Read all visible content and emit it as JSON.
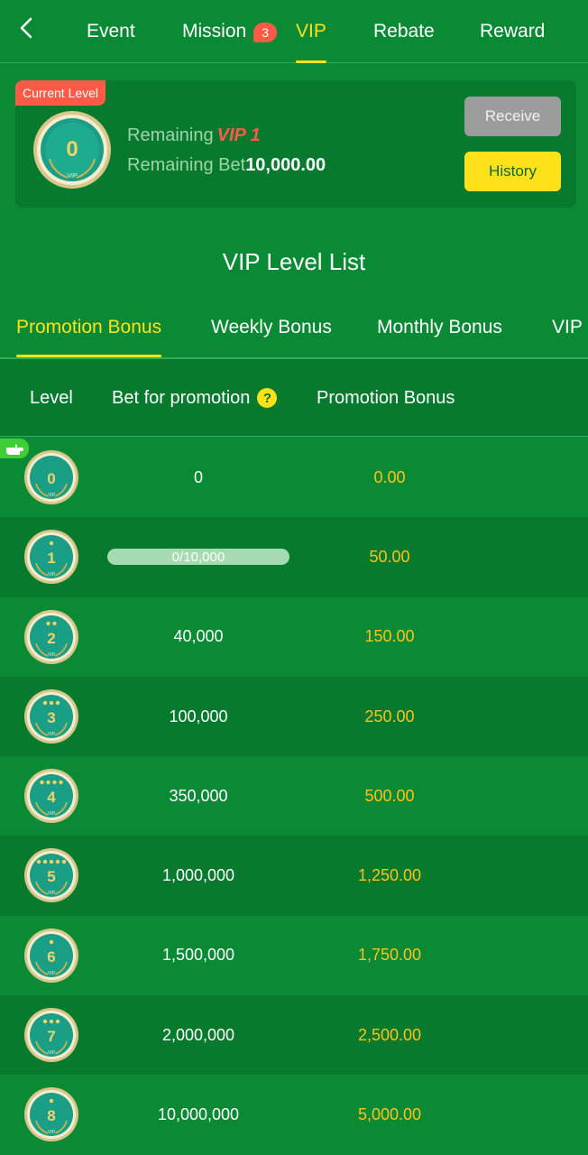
{
  "nav": {
    "tabs": [
      {
        "label": "Event"
      },
      {
        "label": "Mission",
        "badge": "3"
      },
      {
        "label": "VIP",
        "active": true
      },
      {
        "label": "Rebate"
      },
      {
        "label": "Reward"
      }
    ]
  },
  "current": {
    "tag": "Current Level",
    "level": "0",
    "remaining_label": "Remaining",
    "next_vip": "VIP 1",
    "remaining_bet_label": "Remaining Bet",
    "remaining_bet": "10,000.00",
    "receive_label": "Receive",
    "history_label": "History"
  },
  "section_title": "VIP Level List",
  "bonus_tabs": [
    {
      "label": "Promotion Bonus",
      "active": true
    },
    {
      "label": "Weekly Bonus"
    },
    {
      "label": "Monthly Bonus"
    },
    {
      "label": "VIP B"
    }
  ],
  "table": {
    "headers": {
      "level": "Level",
      "bet": "Bet for promotion",
      "help": "?",
      "bonus": "Promotion Bonus"
    },
    "rows": [
      {
        "level": "0",
        "bet": "0",
        "bonus": "0.00",
        "stars": 0
      },
      {
        "level": "1",
        "bet": "0/10,000",
        "bonus": "50.00",
        "stars": 1,
        "progress": 0
      },
      {
        "level": "2",
        "bet": "40,000",
        "bonus": "150.00",
        "stars": 2
      },
      {
        "level": "3",
        "bet": "100,000",
        "bonus": "250.00",
        "stars": 3
      },
      {
        "level": "4",
        "bet": "350,000",
        "bonus": "500.00",
        "stars": 4
      },
      {
        "level": "5",
        "bet": "1,000,000",
        "bonus": "1,250.00",
        "stars": 5
      },
      {
        "level": "6",
        "bet": "1,500,000",
        "bonus": "1,750.00",
        "stars": 1
      },
      {
        "level": "7",
        "bet": "2,000,000",
        "bonus": "2,500.00",
        "stars": 3
      },
      {
        "level": "8",
        "bet": "10,000,000",
        "bonus": "5,000.00",
        "stars": 1
      }
    ]
  },
  "colors": {
    "accent": "#ffe11a",
    "bonus": "#ffc21a",
    "badge": "#ff5a48",
    "bg": "#0b8a35",
    "bg_alt": "#077a2e"
  }
}
